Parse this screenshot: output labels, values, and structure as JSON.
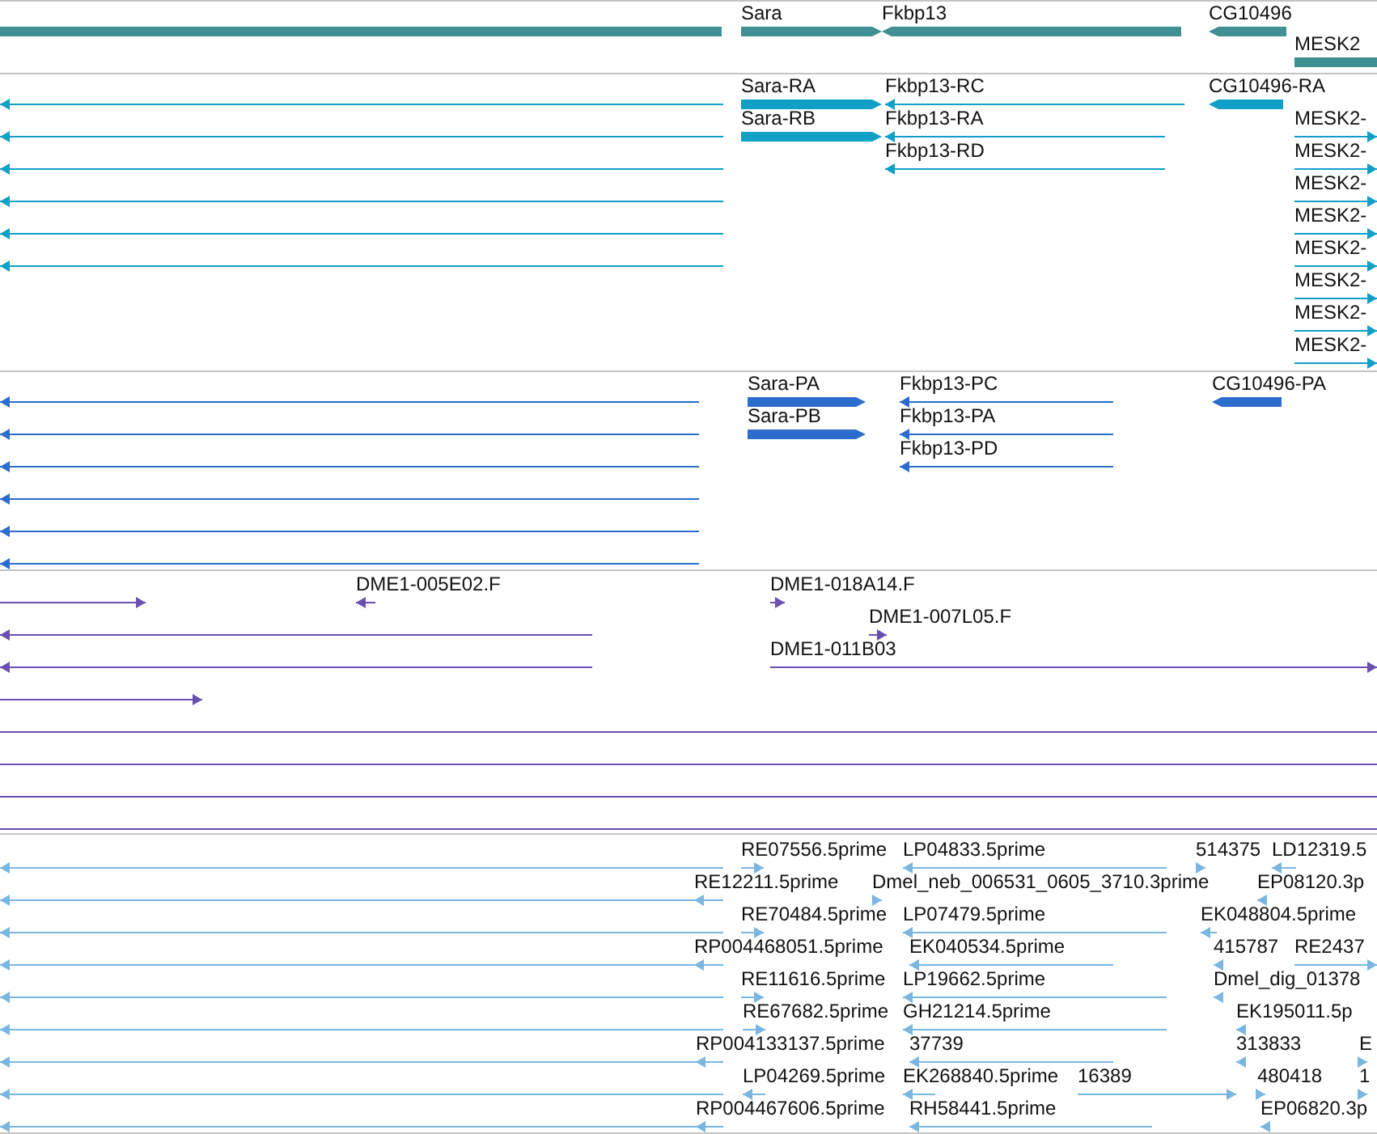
{
  "tracks": [
    {
      "kind": "gene",
      "color": "#3f8f93",
      "features": [
        {
          "kind": "plain"
        },
        {
          "label": "Sara",
          "kind": "forward"
        },
        {
          "label": "Fkbp13",
          "kind": "reverse"
        },
        {
          "label": "CG10496",
          "kind": "reverse"
        },
        {
          "label": "MESK2",
          "kind": "plain"
        }
      ]
    },
    {
      "kind": "transcript",
      "color": "#109fc6",
      "features": [
        {
          "kind": "reverse"
        },
        {
          "kind": "reverse"
        },
        {
          "kind": "reverse"
        },
        {
          "kind": "reverse"
        },
        {
          "kind": "reverse"
        },
        {
          "kind": "reverse"
        },
        {
          "label": "Sara-RA",
          "kind": "forward"
        },
        {
          "label": "Sara-RB",
          "kind": "forward"
        },
        {
          "label": "Fkbp13-RC",
          "kind": "reverse"
        },
        {
          "label": "Fkbp13-RA",
          "kind": "reverse"
        },
        {
          "label": "Fkbp13-RD",
          "kind": "reverse"
        },
        {
          "label": "CG10496-RA",
          "kind": "reverse"
        },
        {
          "label": "MESK2-",
          "kind": "forward"
        },
        {
          "label": "MESK2-",
          "kind": "forward"
        },
        {
          "label": "MESK2-",
          "kind": "forward"
        },
        {
          "label": "MESK2-",
          "kind": "forward"
        },
        {
          "label": "MESK2-",
          "kind": "forward"
        },
        {
          "label": "MESK2-",
          "kind": "forward"
        },
        {
          "label": "MESK2-",
          "kind": "forward"
        },
        {
          "label": "MESK2-",
          "kind": "forward"
        }
      ]
    },
    {
      "kind": "protein",
      "color": "#2b6ccd",
      "features": [
        {
          "kind": "reverse"
        },
        {
          "kind": "reverse"
        },
        {
          "kind": "reverse"
        },
        {
          "kind": "reverse"
        },
        {
          "kind": "reverse"
        },
        {
          "kind": "reverse"
        },
        {
          "label": "Sara-PA",
          "kind": "forward"
        },
        {
          "label": "Sara-PB",
          "kind": "forward"
        },
        {
          "label": "Fkbp13-PC",
          "kind": "reverse"
        },
        {
          "label": "Fkbp13-PA",
          "kind": "reverse"
        },
        {
          "label": "Fkbp13-PD",
          "kind": "reverse"
        },
        {
          "label": "CG10496-PA",
          "kind": "reverse"
        }
      ]
    },
    {
      "kind": "est",
      "color": "#6a50b0",
      "features": [
        {
          "kind": "forward"
        },
        {
          "kind": "reverse"
        },
        {
          "kind": "reverse"
        },
        {
          "kind": "forward"
        },
        {
          "kind": "plain"
        },
        {
          "kind": "plain"
        },
        {
          "kind": "plain"
        },
        {
          "kind": "plain"
        },
        {
          "label": "DME1-005E02.F",
          "kind": "reverse"
        },
        {
          "label": "DME1-018A14.F",
          "kind": "forward"
        },
        {
          "label": "DME1-007L05.F",
          "kind": "forward"
        },
        {
          "label": "DME1-011B03",
          "kind": "forward"
        }
      ]
    },
    {
      "kind": "est",
      "color": "#7ab6e0",
      "features": [
        {
          "kind": "reverse"
        },
        {
          "kind": "reverse"
        },
        {
          "kind": "reverse"
        },
        {
          "kind": "reverse"
        },
        {
          "kind": "reverse"
        },
        {
          "kind": "reverse"
        },
        {
          "kind": "reverse"
        },
        {
          "kind": "reverse"
        },
        {
          "kind": "reverse"
        },
        {
          "label": "RE07556.5prime",
          "kind": "forward"
        },
        {
          "label": "LP04833.5prime",
          "kind": "reverse"
        },
        {
          "label": "514375",
          "kind": "forward"
        },
        {
          "label": "LD12319.5",
          "kind": "reverse"
        },
        {
          "label": "RE12211.5prime",
          "kind": "reverse"
        },
        {
          "label": "Dmel_neb_006531_0605_3710.3prime",
          "kind": "forward"
        },
        {
          "label": "EP08120.3p",
          "kind": "reverse"
        },
        {
          "label": "RE70484.5prime",
          "kind": "forward"
        },
        {
          "label": "LP07479.5prime",
          "kind": "reverse"
        },
        {
          "label": "EK048804.5prime",
          "kind": "reverse"
        },
        {
          "label": "RP004468051.5prime",
          "kind": "reverse"
        },
        {
          "label": "EK040534.5prime",
          "kind": "reverse"
        },
        {
          "label": "415787",
          "kind": "reverse"
        },
        {
          "label": "RE2437",
          "kind": "forward"
        },
        {
          "label": "RE11616.5prime",
          "kind": "forward"
        },
        {
          "label": "LP19662.5prime",
          "kind": "reverse"
        },
        {
          "label": "Dmel_dig_01378",
          "kind": "reverse"
        },
        {
          "label": "RE67682.5prime",
          "kind": "forward"
        },
        {
          "label": "GH21214.5prime",
          "kind": "reverse"
        },
        {
          "label": "EK195011.5p",
          "kind": "reverse"
        },
        {
          "label": "RP004133137.5prime",
          "kind": "reverse"
        },
        {
          "label": "37739",
          "kind": "reverse"
        },
        {
          "label": "313833",
          "kind": "reverse"
        },
        {
          "label": "E",
          "kind": "forward"
        },
        {
          "label": "LP04269.5prime",
          "kind": "reverse"
        },
        {
          "label": "EK268840.5prime",
          "kind": "reverse"
        },
        {
          "label": "16389",
          "kind": "forward"
        },
        {
          "label": "480418",
          "kind": "forward"
        },
        {
          "label": "1",
          "kind": "forward"
        },
        {
          "label": "RP004467606.5prime",
          "kind": "reverse"
        },
        {
          "label": "RH58441.5prime",
          "kind": "reverse"
        },
        {
          "label": "EP06820.3p",
          "kind": "reverse"
        }
      ]
    }
  ]
}
